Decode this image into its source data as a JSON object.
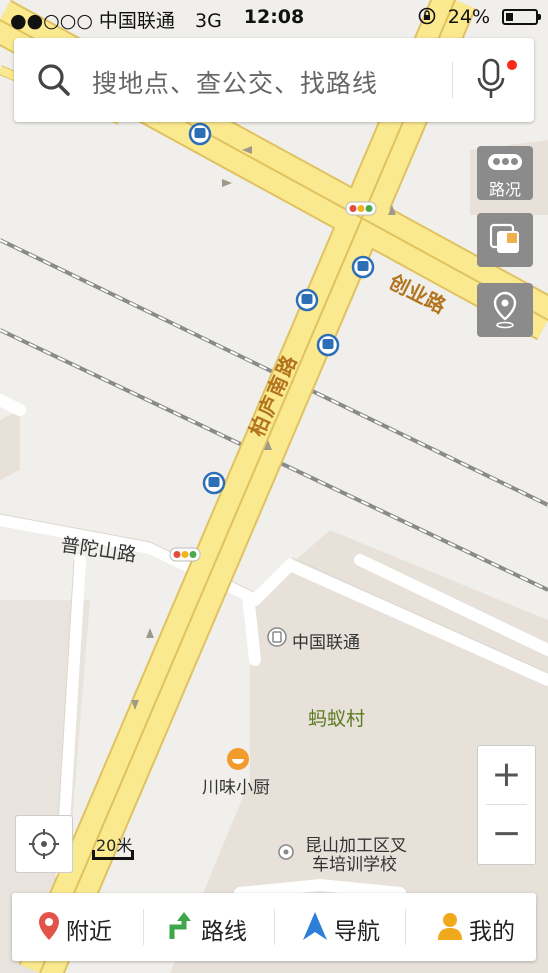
{
  "status_bar": {
    "carrier": "●●○○○ 中国联通",
    "network": "3G",
    "time": "12:08",
    "battery": "24%",
    "battery_level": 0.24
  },
  "search": {
    "placeholder": "搜地点、查公交、找路线",
    "icon": "search-icon",
    "voice_icon": "microphone-icon"
  },
  "tools": {
    "traffic_label": "路况",
    "layers_icon": "layers-icon",
    "pin_icon": "location-pin-icon"
  },
  "zoom": {
    "in": "+",
    "out": "−"
  },
  "scale": {
    "label": "20米"
  },
  "map": {
    "roads": {
      "baipu": "柏庐南路",
      "chuangye": "创业路",
      "putuoshan": "普陀山路"
    },
    "pois": {
      "unicom": "中国联通",
      "village": "蚂蚁村",
      "restaurant": "川味小厨",
      "school_line1": "昆山加工区叉",
      "school_line2": "车培训学校"
    },
    "colors": {
      "land": "#f1efec",
      "road_fill": "#fbe98f",
      "road_edge": "#e0c25f",
      "building": "#e7e1da",
      "bus_stop": "#2d6fb7",
      "railway": "#8a8a8a"
    }
  },
  "nav": {
    "nearby": "附近",
    "route": "路线",
    "navigation": "导航",
    "mine": "我的",
    "colors": {
      "nearby_icon": "#e2534a",
      "route_icon": "#3fa64a",
      "navigation_icon": "#2d7ed8",
      "mine_icon": "#f0a81c"
    }
  }
}
